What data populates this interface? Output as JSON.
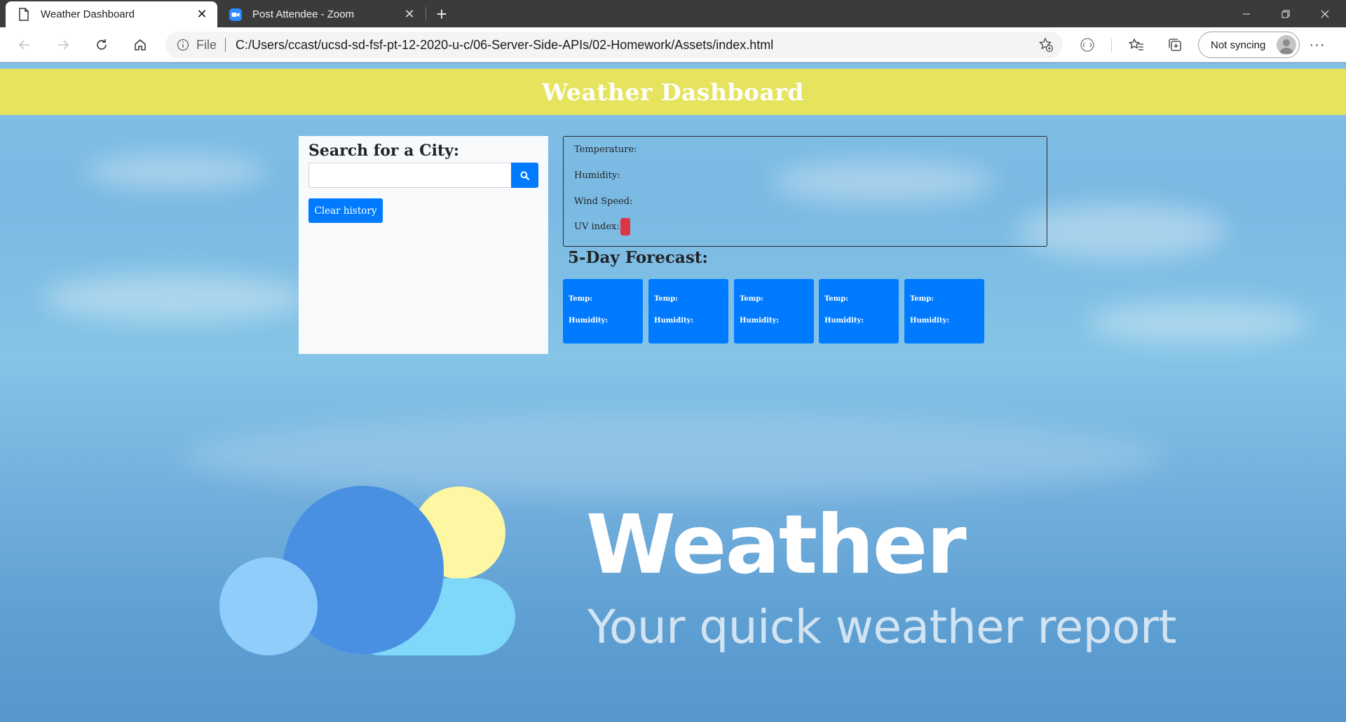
{
  "browser": {
    "tabs": [
      {
        "title": "Weather Dashboard",
        "icon": "page-icon",
        "active": true
      },
      {
        "title": "Post Attendee - Zoom",
        "icon": "zoom-icon",
        "active": false
      }
    ],
    "address": {
      "scheme_label": "File",
      "url": "C:/Users/ccast/ucsd-sd-fsf-pt-12-2020-u-c/06-Server-Side-APIs/02-Homework/Assets/index.html"
    },
    "profile": {
      "label": "Not syncing"
    },
    "more_label": "···"
  },
  "header": {
    "title": "Weather Dashboard"
  },
  "search": {
    "heading": "Search for a City:",
    "input_value": "",
    "clear_label": "Clear history"
  },
  "current": {
    "temperature_label": "Temperature:",
    "humidity_label": "Humidity:",
    "wind_label": "Wind Speed:",
    "uv_label": "UV index:"
  },
  "forecast": {
    "heading": "5-Day Forecast:",
    "cards": [
      {
        "temp_label": "Temp:",
        "humidity_label": "Humidity:"
      },
      {
        "temp_label": "Temp:",
        "humidity_label": "Humidity:"
      },
      {
        "temp_label": "Temp:",
        "humidity_label": "Humidity:"
      },
      {
        "temp_label": "Temp:",
        "humidity_label": "Humidity:"
      },
      {
        "temp_label": "Temp:",
        "humidity_label": "Humidity:"
      }
    ]
  },
  "background_logo": {
    "word": "Weather",
    "tagline": "Your quick weather report"
  },
  "colors": {
    "header_bg": "#e6e35f",
    "primary_button": "#007bff",
    "uv_badge": "#dc3545",
    "panel_bg": "#f8f9fa"
  }
}
